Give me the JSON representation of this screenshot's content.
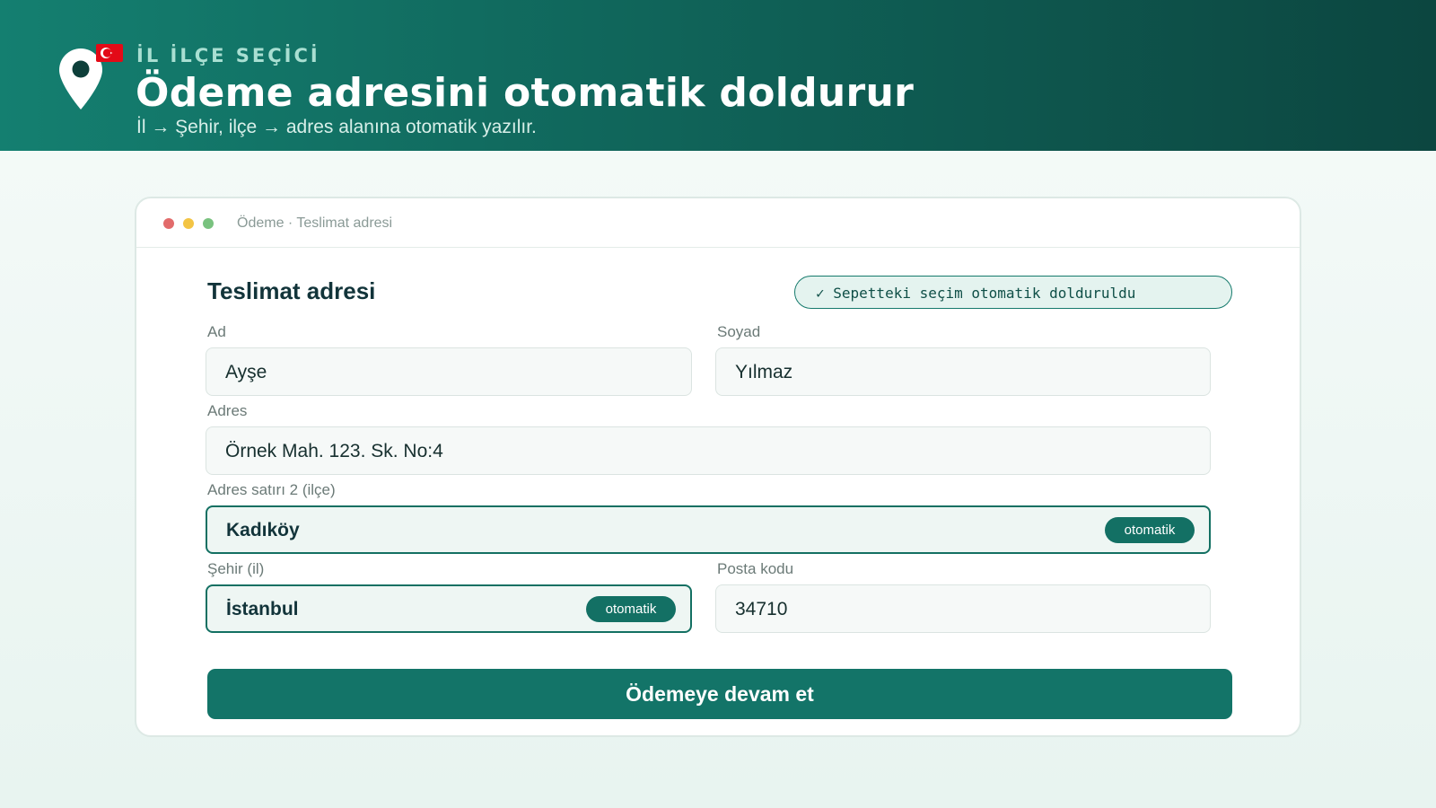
{
  "header": {
    "eyebrow": "İL İLÇE SEÇİCİ",
    "title": "Ödeme adresini otomatik doldurur",
    "subtitle": "İl → Şehir, ilçe → adres alanına otomatik yazılır.",
    "icons": [
      "map-pin-icon",
      "turkey-flag-icon"
    ],
    "colors": {
      "banner": "#0f5f55",
      "accent": "#137468"
    }
  },
  "window": {
    "breadcrumb": "Ödeme · Teslimat adresi",
    "traffic_lights": [
      "#e26b6b",
      "#f3c444",
      "#79c27f"
    ]
  },
  "form": {
    "title": "Teslimat adresi",
    "autofill_notice": "✓ Sepetteki seçim otomatik dolduruldu",
    "fields": {
      "first_name": {
        "label": "Ad",
        "value": "Ayşe"
      },
      "last_name": {
        "label": "Soyad",
        "value": "Yılmaz"
      },
      "address": {
        "label": "Adres",
        "value": "Örnek Mah. 123. Sk. No:4"
      },
      "address2": {
        "label": "Adres satırı 2 (ilçe)",
        "value": "Kadıköy",
        "badge": "otomatik"
      },
      "city": {
        "label": "Şehir (il)",
        "value": "İstanbul",
        "badge": "otomatik"
      },
      "postal_code": {
        "label": "Posta kodu",
        "value": "34710"
      }
    },
    "submit_label": "Ödemeye devam et"
  }
}
